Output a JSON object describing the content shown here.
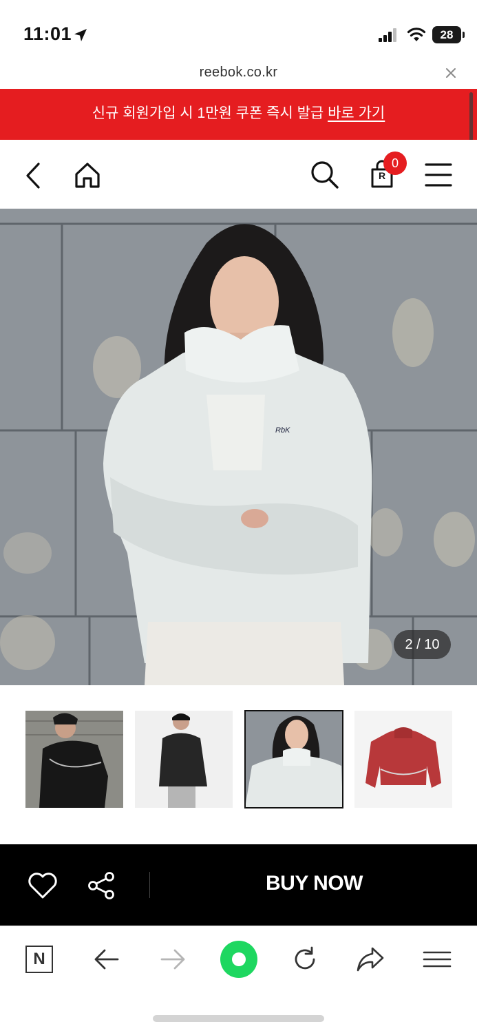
{
  "status": {
    "time": "11:01",
    "battery": "28"
  },
  "browser": {
    "url": "reebok.co.kr"
  },
  "promo": {
    "text": "신규 회원가입 시 1만원 쿠폰 즉시 발급",
    "link": "바로 가기"
  },
  "header": {
    "cart_count": "0",
    "cart_letter": "R"
  },
  "gallery": {
    "counter": "2 / 10",
    "current_index": 2,
    "total": 10,
    "active_thumb": 3
  },
  "actions": {
    "buy_label": "BUY NOW"
  },
  "toolbar": {
    "n_label": "N"
  },
  "colors": {
    "promo": "#e51d20",
    "buy_bar": "#000000",
    "accent_green": "#1ed760"
  },
  "icons": [
    "location-arrow-icon",
    "signal-icon",
    "wifi-icon",
    "close-icon",
    "back-icon",
    "home-icon",
    "search-icon",
    "cart-icon",
    "menu-icon",
    "heart-icon",
    "share-icon",
    "naver-icon",
    "back-arrow-icon",
    "forward-arrow-icon",
    "green-dot-icon",
    "reload-icon",
    "share-arrow-icon",
    "browser-menu-icon"
  ]
}
